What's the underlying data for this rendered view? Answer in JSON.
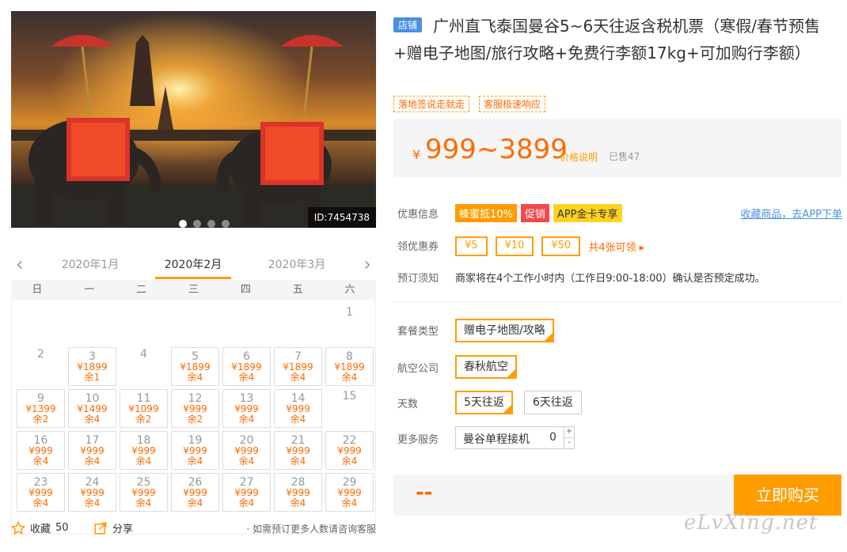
{
  "hero": {
    "id_label": "ID:7454738",
    "dots": 4,
    "active_dot": 0
  },
  "calendar": {
    "prev_month": "2020年1月",
    "current_month": "2020年2月",
    "next_month": "2020年3月",
    "weekdays": [
      "日",
      "一",
      "二",
      "三",
      "四",
      "五",
      "六"
    ],
    "days": [
      {
        "d": "1"
      },
      {
        "d": "2"
      },
      {
        "d": "3",
        "p": "¥1899",
        "r": "余1"
      },
      {
        "d": "4"
      },
      {
        "d": "5",
        "p": "¥1899",
        "r": "余4"
      },
      {
        "d": "6",
        "p": "¥1899",
        "r": "余4"
      },
      {
        "d": "7",
        "p": "¥1899",
        "r": "余4"
      },
      {
        "d": "8",
        "p": "¥1899",
        "r": "余4"
      },
      {
        "d": "9",
        "p": "¥1399",
        "r": "余2"
      },
      {
        "d": "10",
        "p": "¥1499",
        "r": "余4"
      },
      {
        "d": "11",
        "p": "¥1099",
        "r": "余2"
      },
      {
        "d": "12",
        "p": "¥999",
        "r": "余2"
      },
      {
        "d": "13",
        "p": "¥999",
        "r": "余4"
      },
      {
        "d": "14",
        "p": "¥999",
        "r": "余4"
      },
      {
        "d": "15"
      },
      {
        "d": "16",
        "p": "¥999",
        "r": "余4"
      },
      {
        "d": "17",
        "p": "¥999",
        "r": "余4"
      },
      {
        "d": "18",
        "p": "¥999",
        "r": "余4"
      },
      {
        "d": "19",
        "p": "¥999",
        "r": "余4"
      },
      {
        "d": "20",
        "p": "¥999",
        "r": "余4"
      },
      {
        "d": "21",
        "p": "¥999",
        "r": "余4"
      },
      {
        "d": "22",
        "p": "¥999",
        "r": "余4"
      },
      {
        "d": "23",
        "p": "¥999",
        "r": "余4"
      },
      {
        "d": "24",
        "p": "¥999",
        "r": "余4"
      },
      {
        "d": "25",
        "p": "¥999",
        "r": "余4"
      },
      {
        "d": "26",
        "p": "¥999",
        "r": "余4"
      },
      {
        "d": "27",
        "p": "¥999",
        "r": "余4"
      },
      {
        "d": "28",
        "p": "¥999",
        "r": "余4"
      },
      {
        "d": "29",
        "p": "¥999",
        "r": "余4"
      }
    ]
  },
  "bottom": {
    "fav_label": "收藏",
    "fav_count": "50",
    "share_label": "分享",
    "note": "· 如需预订更多人数请咨询客服"
  },
  "product": {
    "shop_badge": "店铺",
    "title": "广州直飞泰国曼谷5~6天往返含税机票（寒假/春节预售+赠电子地图/旅行攻略+免费行李额17kg+可加购行李额）",
    "tags": [
      "落地签说走就走",
      "客服极速响应"
    ],
    "currency": "¥",
    "price": "999~3899",
    "price_explain": "价格说明",
    "sold": "已售47"
  },
  "promo": {
    "label": "优惠信息",
    "items": [
      "蜂蜜抵10%",
      "促销",
      "APP金卡专享"
    ],
    "app_link": "收藏商品，去APP下单"
  },
  "coupons": {
    "label": "领优惠券",
    "items": [
      "¥5",
      "¥10",
      "¥50"
    ],
    "more": "共4张可领 ▸"
  },
  "notice": {
    "label": "预订须知",
    "text": "商家将在4个工作小时内（工作日9:00-18:00）确认是否预定成功。"
  },
  "options": {
    "package_label": "套餐类型",
    "package": "赠电子地图/攻略",
    "airline_label": "航空公司",
    "airline": "春秋航空",
    "days_label": "天数",
    "days": [
      "5天往返",
      "6天往返"
    ],
    "service_label": "更多服务",
    "service_name": "曼谷单程接机",
    "service_qty": "0"
  },
  "buy": {
    "total": "--",
    "button": "立即购买"
  },
  "watermark": "eLvXing.net",
  "colors": {
    "accent": "#ff9d00",
    "price": "#ff6a00",
    "link": "#4a90e2"
  }
}
